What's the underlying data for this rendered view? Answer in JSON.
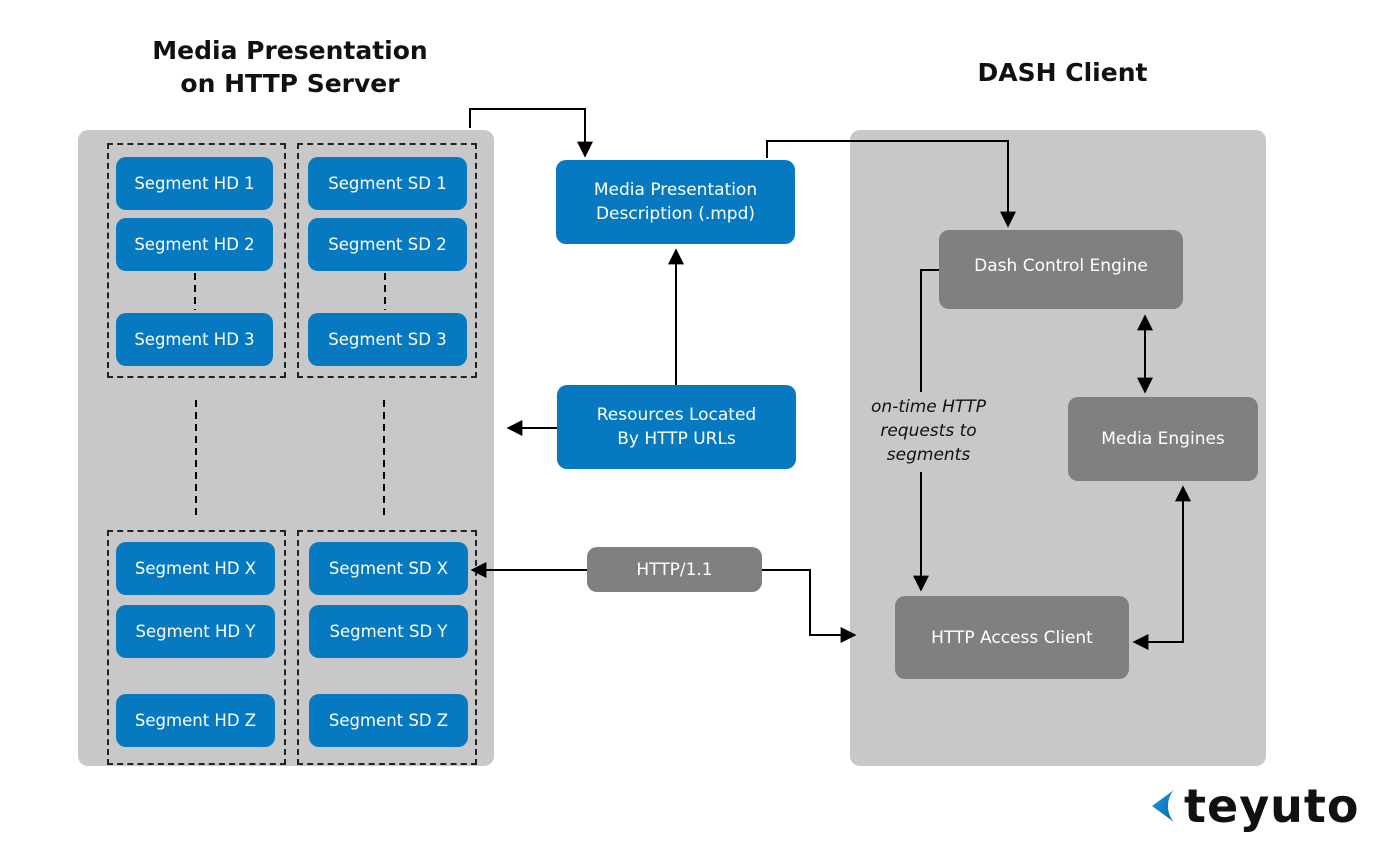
{
  "titles": {
    "server_line1": "Media Presentation",
    "server_line2": "on HTTP Server",
    "client": "DASH Client"
  },
  "server": {
    "hd_top": [
      "Segment HD 1",
      "Segment HD 2",
      "Segment HD 3"
    ],
    "sd_top": [
      "Segment SD 1",
      "Segment SD 2",
      "Segment SD 3"
    ],
    "hd_bottom": [
      "Segment HD X",
      "Segment HD Y",
      "Segment HD Z"
    ],
    "sd_bottom": [
      "Segment SD X",
      "Segment SD Y",
      "Segment SD Z"
    ]
  },
  "middle": {
    "mpd_line1": "Media Presentation",
    "mpd_line2": "Description (.mpd)",
    "resources_line1": "Resources Located",
    "resources_line2": "By HTTP URLs",
    "protocol": "HTTP/1.1"
  },
  "client": {
    "control_engine": "Dash Control Engine",
    "media_engines": "Media Engines",
    "access_client": "HTTP Access Client",
    "note_line1": "on-time HTTP",
    "note_line2": "requests to",
    "note_line3": "segments"
  },
  "brand": {
    "name": "teyuto",
    "icon": "chevron-left-icon",
    "accent": "#0679c0"
  },
  "colors": {
    "segment_blue": "#0679c0",
    "client_gray": "#808080",
    "panel_gray": "#c8c8c8"
  }
}
